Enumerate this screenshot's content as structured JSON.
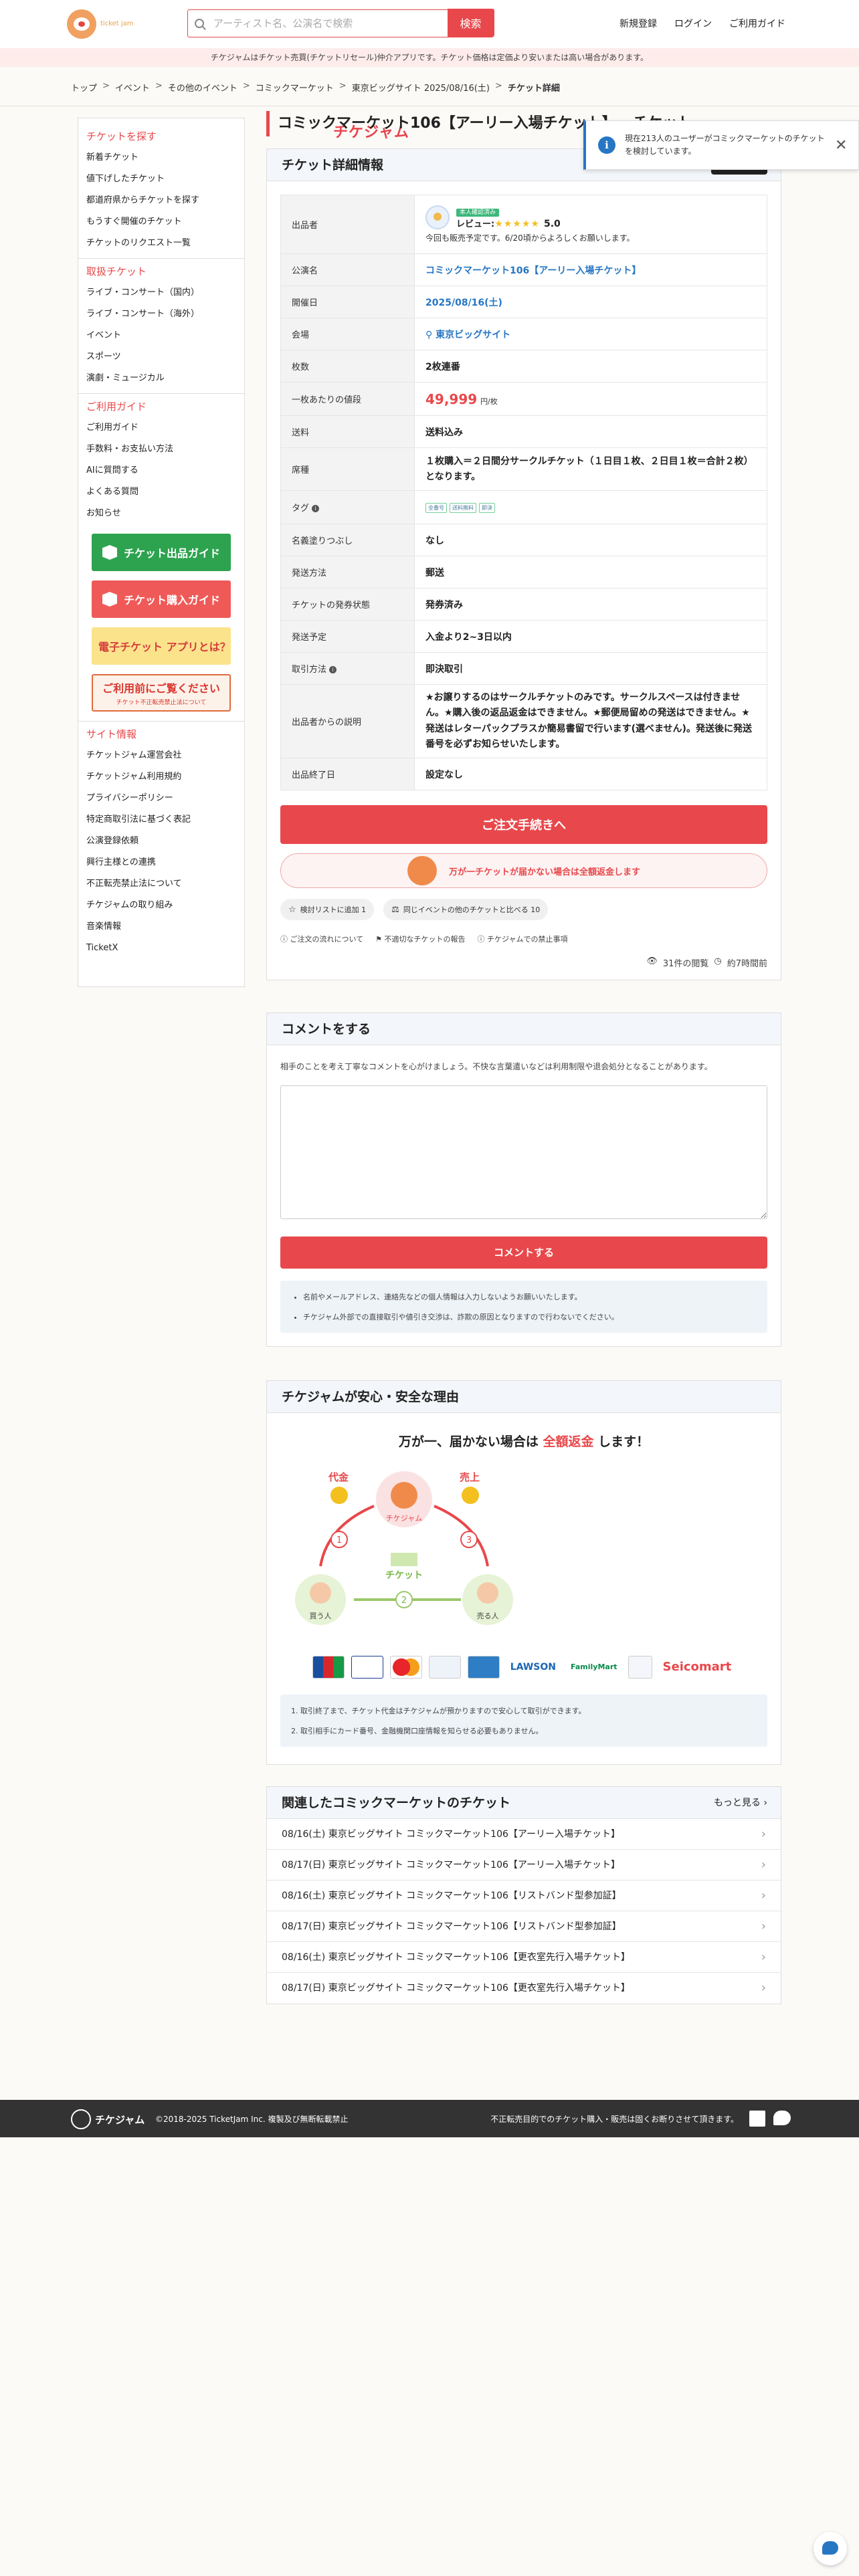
{
  "header": {
    "logo_main": "チケジャム",
    "logo_sub": "ticket jam",
    "search_placeholder": "アーティスト名、公演名で検索",
    "search_button": "検索",
    "nav": [
      "新規登録",
      "ログイン",
      "ご利用ガイド"
    ]
  },
  "notice": "チケジャムはチケット売買(チケットリセール)仲介アプリです。チケット価格は定価より安いまたは高い場合があります。",
  "breadcrumb": [
    "トップ",
    "イベント",
    "その他のイベント",
    "コミックマーケット",
    "東京ビッグサイト 2025/08/16(土)",
    "チケット詳細"
  ],
  "sidebar": {
    "sections": [
      {
        "head": "チケットを探す",
        "items": [
          "新着チケット",
          "値下げしたチケット",
          "都道府県からチケットを探す",
          "もうすぐ開催のチケット",
          "チケットのリクエスト一覧"
        ]
      },
      {
        "head": "取扱チケット",
        "items": [
          "ライブ・コンサート（国内）",
          "ライブ・コンサート（海外）",
          "イベント",
          "スポーツ",
          "演劇・ミュージカル"
        ]
      },
      {
        "head": "ご利用ガイド",
        "items": [
          "ご利用ガイド",
          "手数料・お支払い方法",
          "AIに質問する",
          "よくある質問",
          "お知らせ"
        ]
      }
    ],
    "banners": {
      "sell": "チケット出品ガイド",
      "buy": "チケット購入ガイド",
      "digital": "電子チケット アプリとは？",
      "caution_main": "ご利用前にご覧ください",
      "caution_sub": "チケット不正転売禁止法について"
    },
    "site_info": {
      "head": "サイト情報",
      "items": [
        "チケットジャム運営会社",
        "チケットジャム利用規約",
        "プライバシーポリシー",
        "特定商取引法に基づく表記",
        "公演登録依頼",
        "興行主様との連携",
        "不正転売禁止法について",
        "チケジャムの取り組み",
        "音楽情報",
        "TicketX"
      ]
    }
  },
  "page_title": "コミックマーケット106【アーリー入場チケット】 - チケット",
  "detail": {
    "head": "チケット詳細情報",
    "rows": {
      "seller_label": "出品者",
      "seller_verified": "本人確認済み",
      "seller_review": "レビュー:",
      "seller_stars": "★★★★★",
      "seller_score": "5.0",
      "seller_note": "今回も販売予定です。6/20頃からよろしくお願いします。",
      "event_label": "公演名",
      "event_value": "コミックマーケット106【アーリー入場チケット】",
      "date_label": "開催日",
      "date_value": "2025/08/16(土)",
      "venue_label": "会場",
      "venue_value": "東京ビッグサイト",
      "count_label": "枚数",
      "count_value": "2枚連番",
      "price_label": "一枚あたりの値段",
      "price_value": "49,999",
      "price_unit": "円/枚",
      "shipping_label": "送料",
      "shipping_value": "送料込み",
      "seat_label": "席種",
      "seat_value": "１枚購入＝２日間分サークルチケット（１日目１枚、２日目１枚＝合計２枚）となります。",
      "tag_label": "タグ",
      "tags": [
        "全番号",
        "送料無料",
        "即決"
      ],
      "name_label": "名義塗りつぶし",
      "name_value": "なし",
      "method_label": "発送方法",
      "method_value": "郵送",
      "issue_label": "チケットの発券状態",
      "issue_value": "発券済み",
      "schedule_label": "発送予定",
      "schedule_value": "入金より2~3日以内",
      "trade_label": "取引方法",
      "trade_value": "即決取引",
      "desc_label": "出品者からの説明",
      "desc_value": "★お譲りするのはサークルチケットのみです。サークルスペースは付きません。★購入後の返品返金はできません。★郵便局留めの発送はできません。★発送はレターパックプラスか簡易書留で行います(選べません)。発送後に発送番号を必ずお知らせいたします。",
      "end_label": "出品終了日",
      "end_value": "設定なし"
    },
    "order_button": "ご注文手続きへ",
    "guarantee": "万が一チケットが届かない場合は全額返金します",
    "chips": [
      "検討リストに追加 1",
      "同じイベントの他のチケットと比べる 10"
    ],
    "mini_links": [
      "ご注文の流れについて",
      "不適切なチケットの報告",
      "チケジャムでの禁止事項"
    ],
    "views": "31件の閲覧",
    "time": "約7時間前"
  },
  "comment": {
    "head": "コメントをする",
    "note": "相手のことを考え丁寧なコメントを心がけましょう。不快な言葉遣いなどは利用制限や退会処分となることがあります。",
    "button": "コメントする",
    "rules": [
      "名前やメールアドレス、連絡先などの個人情報は入力しないようお願いいたします。",
      "チケジャム外部での直接取引や値引き交渉は、詐欺の原因となりますので行わないでください。"
    ]
  },
  "safe": {
    "head": "チケジャムが安心・安全な理由",
    "title_pre": "万が一、届かない場合は",
    "title_red": "全額返金",
    "title_post": "します！",
    "flow_price": "代金",
    "flow_sales": "売上",
    "flow_ticket": "チケット",
    "flow_buyer": "買う人",
    "flow_seller": "売る人",
    "flow_center": "チケジャム",
    "pay_lawson": "LAWSON",
    "pay_familymart": "FamilyMart",
    "pay_seicomart": "Seicomart",
    "list": [
      "取引終了まで、チケット代金はチケジャムが預かりますので安心して取引ができます。",
      "取引相手にカード番号、金融機関口座情報を知らせる必要もありません。"
    ]
  },
  "related": {
    "head": "関連したコミックマーケットのチケット",
    "more": "もっと見る",
    "items": [
      "08/16(土) 東京ビッグサイト コミックマーケット106【アーリー入場チケット】",
      "08/17(日) 東京ビッグサイト コミックマーケット106【アーリー入場チケット】",
      "08/16(土) 東京ビッグサイト コミックマーケット106【リストバンド型参加証】",
      "08/17(日) 東京ビッグサイト コミックマーケット106【リストバンド型参加証】",
      "08/16(土) 東京ビッグサイト コミックマーケット106【更衣室先行入場チケット】",
      "08/17(日) 東京ビッグサイト コミックマーケット106【更衣室先行入場チケット】"
    ]
  },
  "toast": {
    "text": "現在213人のユーザーがコミックマーケットのチケットを検討しています。"
  },
  "footer": {
    "logo": "チケジャム",
    "copyright": "©2018-2025 TicketJam Inc. 複製及び無断転載禁止",
    "right": "不正転売目的でのチケット購入・販売は固くお断りさせて頂きます。"
  },
  "colors": {
    "accent": "#e8484b",
    "link": "#2676c4"
  }
}
